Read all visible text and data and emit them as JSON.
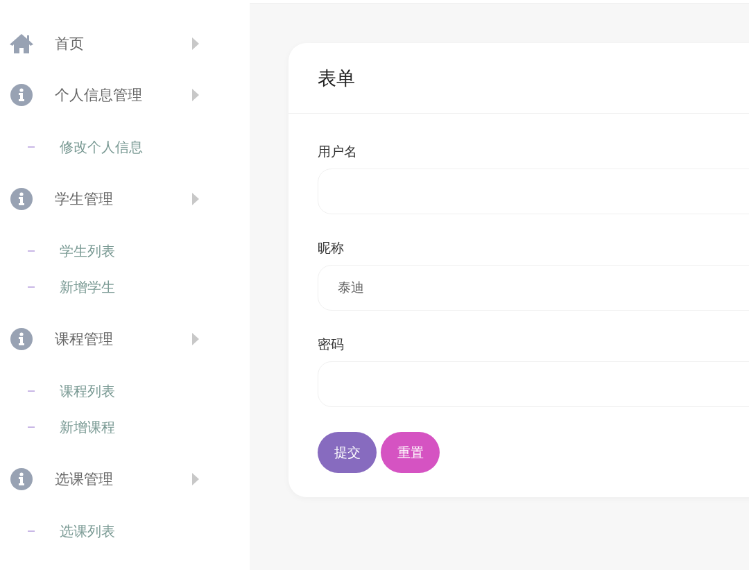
{
  "sidebar": {
    "items": [
      {
        "label": "首页",
        "kind": "home"
      },
      {
        "label": "个人信息管理",
        "kind": "info",
        "children": [
          {
            "label": "修改个人信息"
          }
        ]
      },
      {
        "label": "学生管理",
        "kind": "info",
        "children": [
          {
            "label": "学生列表"
          },
          {
            "label": "新增学生"
          }
        ]
      },
      {
        "label": "课程管理",
        "kind": "info",
        "children": [
          {
            "label": "课程列表"
          },
          {
            "label": "新增课程"
          }
        ]
      },
      {
        "label": "选课管理",
        "kind": "info",
        "children": [
          {
            "label": "选课列表"
          }
        ]
      }
    ]
  },
  "card": {
    "title": "表单",
    "fields": [
      {
        "label": "用户名"
      },
      {
        "label": "昵称",
        "value": "泰迪"
      },
      {
        "label": "密码"
      }
    ],
    "buttons": [
      {
        "label": "提交",
        "kind": "primary"
      },
      {
        "label": "重置",
        "kind": "reset"
      }
    ]
  }
}
